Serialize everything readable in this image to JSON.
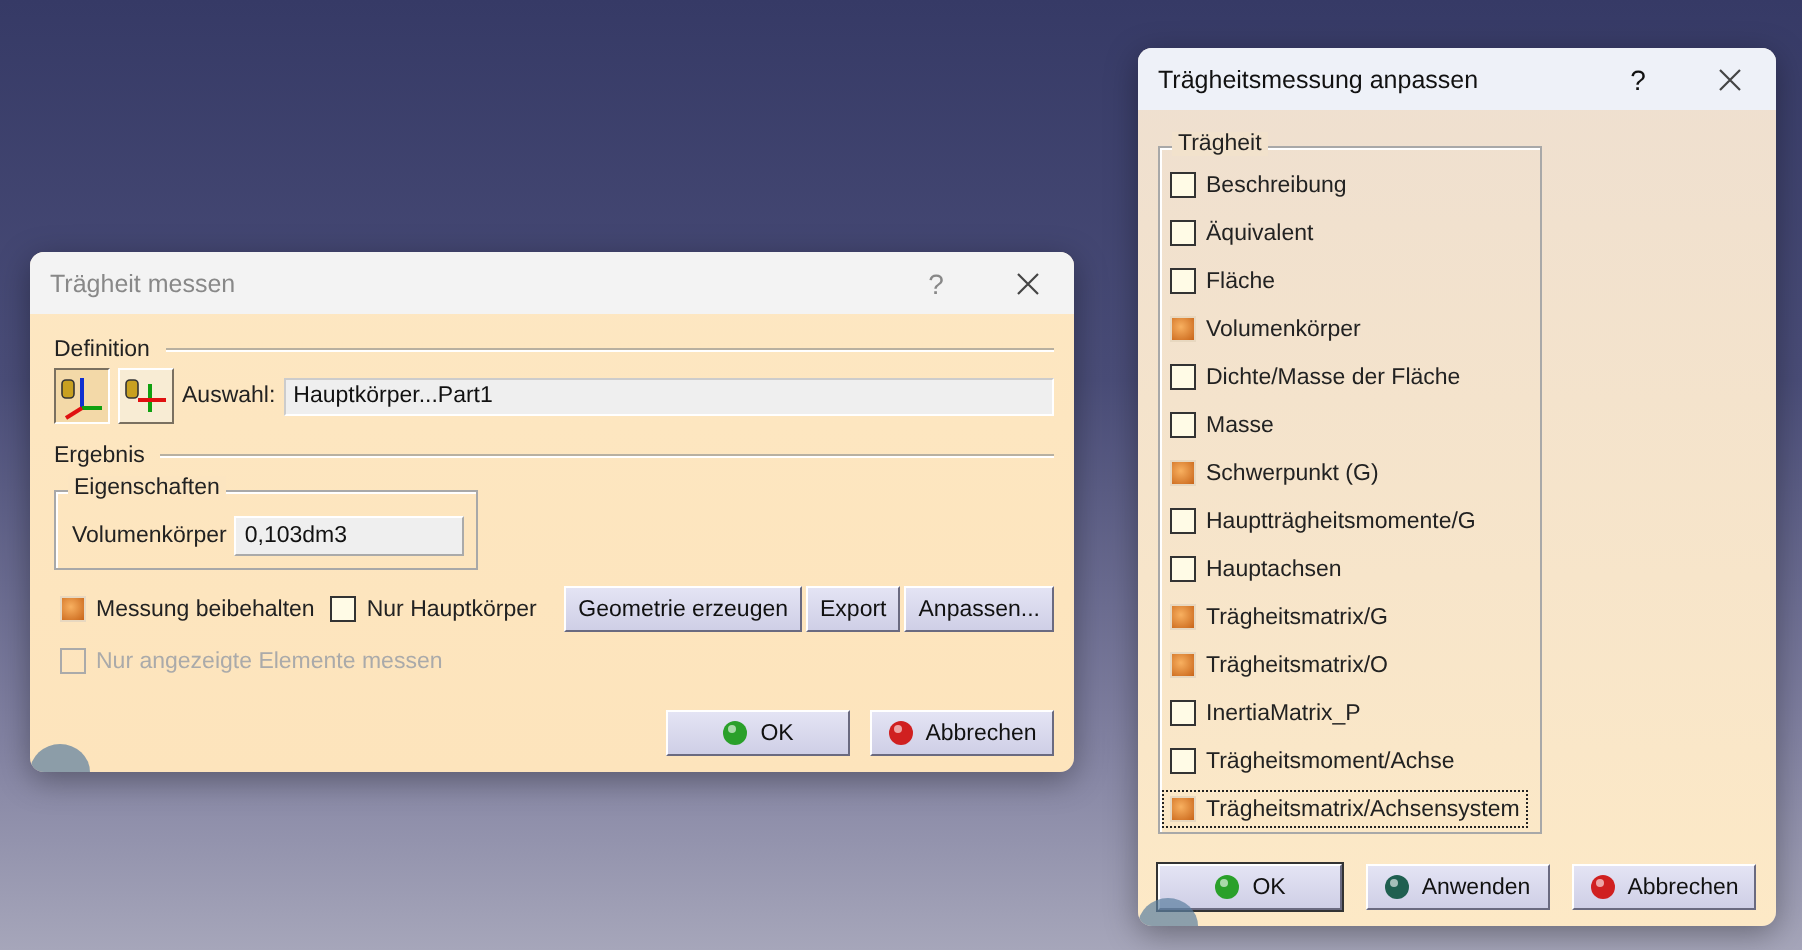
{
  "measure_dialog": {
    "title": "Trägheit messen",
    "help": "?",
    "definition": {
      "label": "Definition",
      "tools": [
        {
          "kind": "axis",
          "selected": true
        },
        {
          "kind": "frame",
          "selected": false
        }
      ],
      "selection_label": "Auswahl:",
      "selection_value": "Hauptkörper...Part1"
    },
    "result": {
      "label": "Ergebnis",
      "group_label": "Eigenschaften",
      "property_label": "Volumenkörper",
      "property_value": "0,103dm3"
    },
    "options": [
      {
        "label": "Messung beibehalten",
        "checked": true,
        "disabled": false
      },
      {
        "label": "Nur Hauptkörper",
        "checked": false,
        "disabled": false
      }
    ],
    "action_buttons": [
      "Geometrie erzeugen",
      "Export",
      "Anpassen..."
    ],
    "extra_option": {
      "label": "Nur angezeigte Elemente messen",
      "checked": false,
      "disabled": true
    },
    "buttons": [
      {
        "kind": "ok",
        "label": "OK",
        "default": false
      },
      {
        "kind": "cancel",
        "label": "Abbrechen",
        "default": false
      }
    ]
  },
  "customize_dialog": {
    "title": "Trägheitsmessung anpassen",
    "help": "?",
    "group_label": "Trägheit",
    "items": [
      {
        "label": "Beschreibung",
        "checked": false,
        "focused": false
      },
      {
        "label": "Äquivalent",
        "checked": false,
        "focused": false
      },
      {
        "label": "Fläche",
        "checked": false,
        "focused": false
      },
      {
        "label": "Volumenkörper",
        "checked": true,
        "focused": false
      },
      {
        "label": "Dichte/Masse der Fläche",
        "checked": false,
        "focused": false
      },
      {
        "label": "Masse",
        "checked": false,
        "focused": false
      },
      {
        "label": "Schwerpunkt (G)",
        "checked": true,
        "focused": false
      },
      {
        "label": "Hauptträgheitsmomente/G",
        "checked": false,
        "focused": false
      },
      {
        "label": "Hauptachsen",
        "checked": false,
        "focused": false
      },
      {
        "label": "Trägheitsmatrix/G",
        "checked": true,
        "focused": false
      },
      {
        "label": "Trägheitsmatrix/O",
        "checked": true,
        "focused": false
      },
      {
        "label": "InertiaMatrix_P",
        "checked": false,
        "focused": false
      },
      {
        "label": "Trägheitsmoment/Achse",
        "checked": false,
        "focused": false
      },
      {
        "label": "Trägheitsmatrix/Achsensystem",
        "checked": true,
        "focused": true
      }
    ],
    "buttons": [
      {
        "kind": "ok",
        "label": "OK",
        "default": true
      },
      {
        "kind": "apply",
        "label": "Anwenden",
        "default": false
      },
      {
        "kind": "cancel",
        "label": "Abbrechen",
        "default": false
      }
    ]
  }
}
